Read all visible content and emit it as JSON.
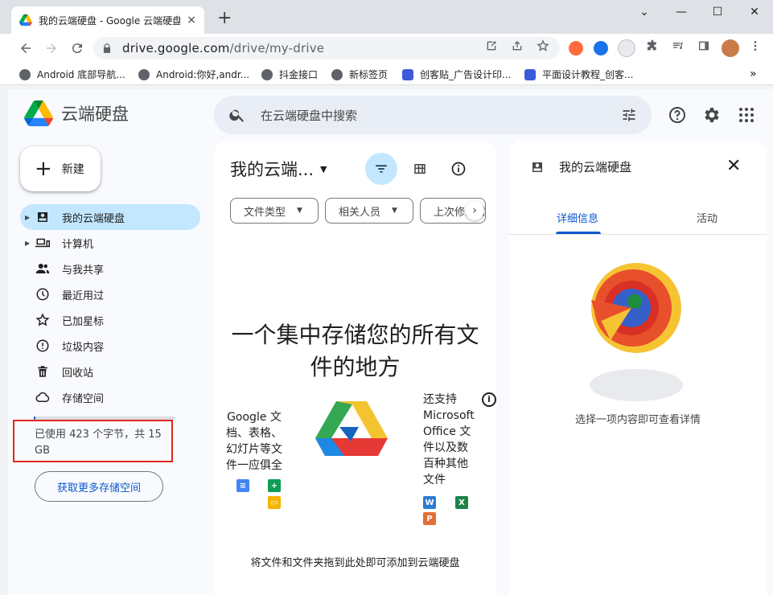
{
  "browser": {
    "tab_title": "我的云端硬盘 - Google 云端硬盘",
    "tab_close": "×",
    "new_tab": "+",
    "window_controls": {
      "minimize": "⌄",
      "min": "—",
      "max": "☐",
      "close": "✕"
    },
    "url_host": "drive.google.com",
    "url_path": "/drive/my-drive",
    "bookmarks": [
      "Android 底部导航...",
      "Android:你好,andr...",
      "抖金接口",
      "新标签页",
      "创客贴_广告设计印...",
      "平面设计教程_创客..."
    ],
    "bookmarks_overflow": "»"
  },
  "app": {
    "brand": "云端硬盘",
    "search_placeholder": "在云端硬盘中搜索",
    "new_button": "新建",
    "nav": [
      {
        "label": "我的云端硬盘",
        "icon": "drive-icon",
        "active": true,
        "expandable": true
      },
      {
        "label": "计算机",
        "icon": "computer-icon",
        "active": false,
        "expandable": true
      },
      {
        "label": "与我共享",
        "icon": "shared-icon",
        "active": false,
        "expandable": false
      },
      {
        "label": "最近用过",
        "icon": "clock-icon",
        "active": false,
        "expandable": false
      },
      {
        "label": "已加星标",
        "icon": "star-icon",
        "active": false,
        "expandable": false
      },
      {
        "label": "垃圾内容",
        "icon": "spam-icon",
        "active": false,
        "expandable": false
      },
      {
        "label": "回收站",
        "icon": "trash-icon",
        "active": false,
        "expandable": false
      },
      {
        "label": "存储空间",
        "icon": "cloud-icon",
        "active": false,
        "expandable": false
      }
    ],
    "storage_text": "已使用 423 个字节，共 15 GB",
    "storage_fraction": 0.005,
    "more_storage": "获取更多存储空间"
  },
  "main": {
    "title": "我的云端...",
    "chips": [
      "文件类型",
      "相关人员",
      "上次修改时间"
    ],
    "hero": "一个集中存储您的所有文件的地方",
    "left_text": "Google 文档、表格、幻灯片等文件一应俱全",
    "right_text": "还支持 Microsoft Office 文件以及数百种其他文件",
    "mini_w": "W",
    "mini_x": "X",
    "mini_p": "P",
    "info_i": "i",
    "drop_text": "将文件和文件夹拖到此处即可添加到云端硬盘"
  },
  "details": {
    "title": "我的云端硬盘",
    "close": "✕",
    "tab_info": "详细信息",
    "tab_activity": "活动",
    "empty_text": "选择一项内容即可查看详情"
  },
  "colors": {
    "accent": "#0b57d0",
    "active_bg": "#c2e7ff",
    "highlight_box": "#e0271c"
  }
}
